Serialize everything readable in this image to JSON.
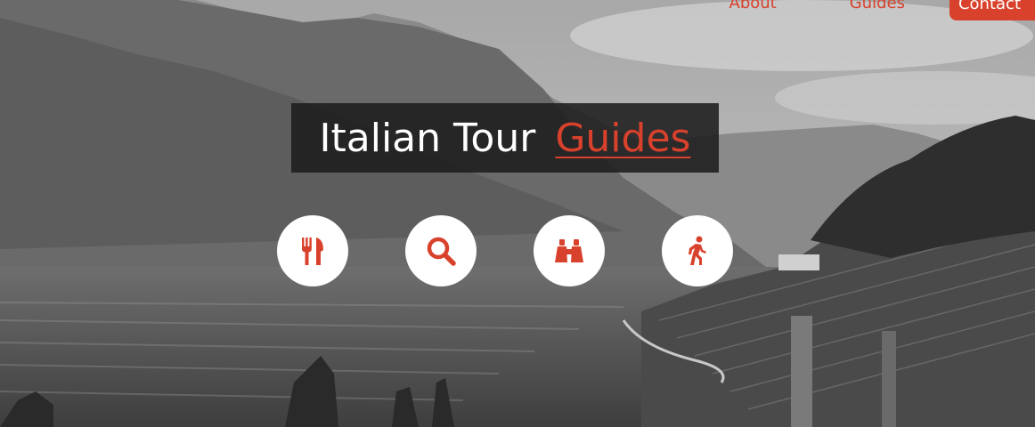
{
  "nav": {
    "items": [
      "About",
      "Guides"
    ],
    "contact_label": "Contact"
  },
  "hero": {
    "title_main": "Italian Tour",
    "title_accent": "Guides"
  },
  "feature_icons": [
    {
      "icon": "fork-knife-icon"
    },
    {
      "icon": "search-icon"
    },
    {
      "icon": "binoculars-icon"
    },
    {
      "icon": "walking-person-icon"
    }
  ],
  "colors": {
    "accent": "#d8412c",
    "title_box_bg": "#1c1c1c",
    "circle_bg": "#ffffff"
  }
}
